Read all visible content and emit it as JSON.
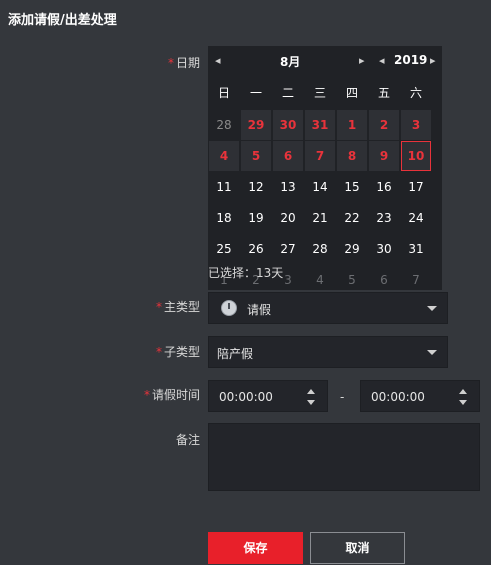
{
  "dialog": {
    "title": "添加请假/出差处理"
  },
  "form": {
    "required_mark": "*",
    "date_label": "日期",
    "main_type_label": "主类型",
    "sub_type_label": "子类型",
    "leave_time_label": "请假时间",
    "remark_label": "备注",
    "main_type_value": "请假",
    "main_type_icon": "clock-icon",
    "sub_type_value": "陪产假",
    "time_start": "00:00:00",
    "time_separator": "-",
    "time_end": "00:00:00",
    "remark_value": ""
  },
  "calendar": {
    "prev_month": "◂",
    "month": "8月",
    "next_month": "▸",
    "prev_year": "◂",
    "year": "2019",
    "next_year": "▸",
    "weekdays": [
      "日",
      "一",
      "二",
      "三",
      "四",
      "五",
      "六"
    ],
    "weeks": [
      [
        "28",
        "29",
        "30",
        "31",
        "1",
        "2",
        "3"
      ],
      [
        "4",
        "5",
        "6",
        "7",
        "8",
        "9",
        "10"
      ],
      [
        "11",
        "12",
        "13",
        "14",
        "15",
        "16",
        "17"
      ],
      [
        "18",
        "19",
        "20",
        "21",
        "22",
        "23",
        "24"
      ],
      [
        "25",
        "26",
        "27",
        "28",
        "29",
        "30",
        "31"
      ],
      [
        "1",
        "2",
        "3",
        "4",
        "5",
        "6",
        "7"
      ]
    ],
    "selected_info": "已选择：13天",
    "accent_color": "#e8333b"
  },
  "buttons": {
    "save": "保存",
    "cancel": "取消"
  }
}
